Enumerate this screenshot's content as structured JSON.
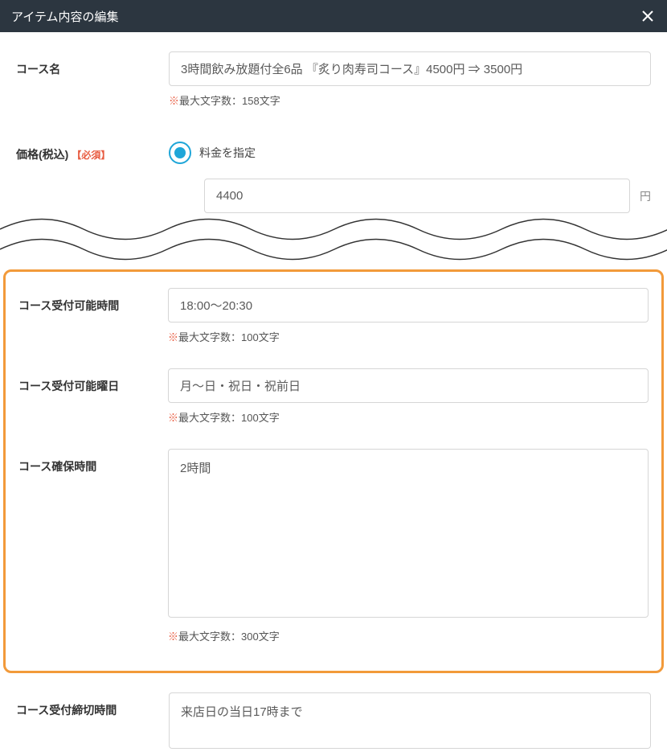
{
  "header": {
    "title": "アイテム内容の編集"
  },
  "course_name": {
    "label": "コース名",
    "value": "3時間飲み放題付全6品 『炙り肉寿司コース』4500円 ⇒ 3500円",
    "hint": "最大文字数：158文字"
  },
  "price": {
    "label": "価格(税込)",
    "required": "【必須】",
    "radio_label": "料金を指定",
    "value": "4400",
    "unit": "円"
  },
  "accept_time": {
    "label": "コース受付可能時間",
    "value": "18:00〜20:30",
    "hint": "最大文字数：100文字"
  },
  "accept_days": {
    "label": "コース受付可能曜日",
    "value": "月〜日・祝日・祝前日",
    "hint": "最大文字数：100文字"
  },
  "reserve_duration": {
    "label": "コース確保時間",
    "value": "2時間",
    "hint": "最大文字数：300文字"
  },
  "deadline": {
    "label": "コース受付締切時間",
    "value": "来店日の当日17時まで"
  },
  "star": "※"
}
